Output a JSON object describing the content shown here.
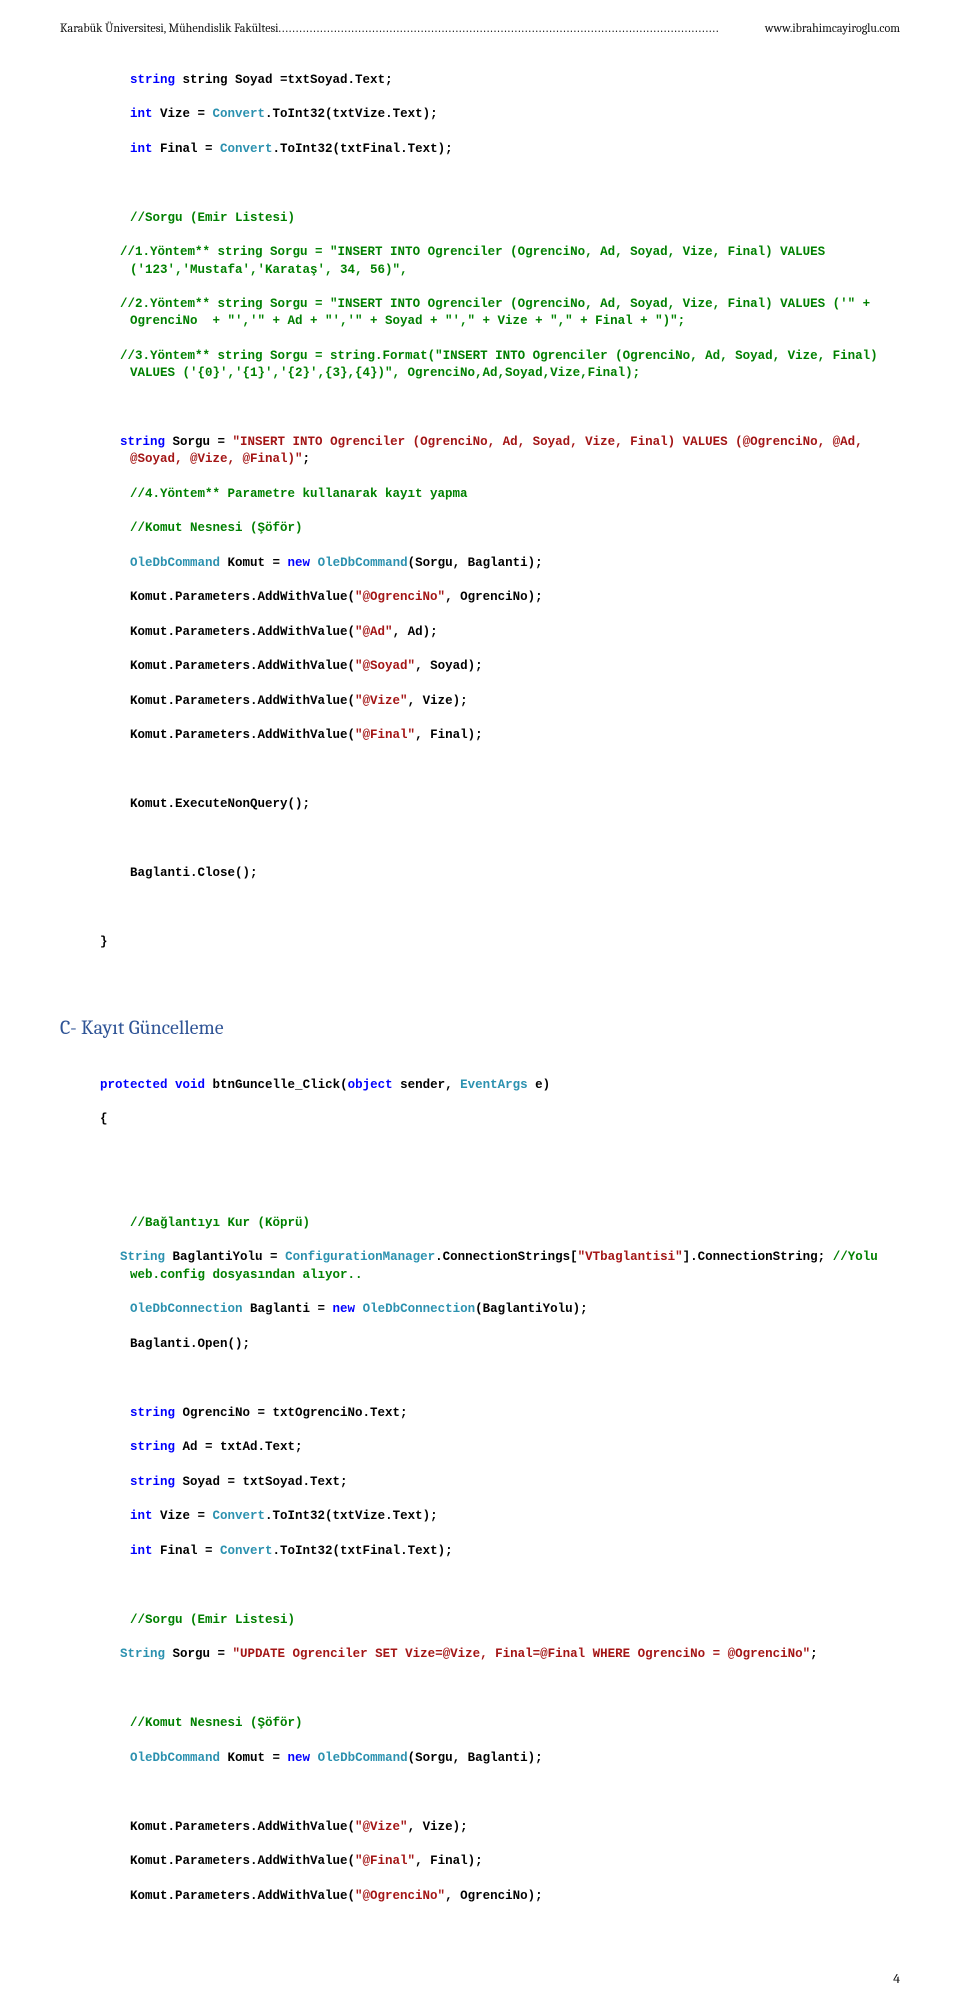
{
  "header": {
    "left": "Karabük Üniversitesi, Mühendislik Fakültesi",
    "right": "www.ibrahimcayiroglu.com"
  },
  "code1": {
    "l01": "string Soyad =txtSoyad.Text;",
    "l02a": "int Vize = ",
    "l02b": "Convert",
    "l02c": ".ToInt32(txtVize.Text);",
    "l03a": "int Final = ",
    "l03b": "Convert",
    "l03c": ".ToInt32(txtFinal.Text);",
    "l05": "//Sorgu (Emir Listesi)",
    "l06": "//1.Yöntem** string Sorgu = \"INSERT INTO Ogrenciler (OgrenciNo, Ad, Soyad, Vize, Final) VALUES ('123','Mustafa','Karataş', 34, 56)\",",
    "l07": "//2.Yöntem** string Sorgu = \"INSERT INTO Ogrenciler (OgrenciNo, Ad, Soyad, Vize, Final) VALUES ('\" + OgrenciNo  + \"','\" + Ad + \"','\" + Soyad + \"',\" + Vize + \",\" + Final + \")\";",
    "l08": "//3.Yöntem** string Sorgu = string.Format(\"INSERT INTO Ogrenciler (OgrenciNo, Ad, Soyad, Vize, Final) VALUES ('{0}','{1}','{2}',{3},{4})\", OgrenciNo,Ad,Soyad,Vize,Final);",
    "l09a": "string Sorgu = ",
    "l09b": "\"INSERT INTO Ogrenciler (OgrenciNo, Ad, Soyad, Vize, Final) VALUES (@OgrenciNo, @Ad, @Soyad, @Vize, @Final)\"",
    "l09c": ";",
    "l10": "//4.Yöntem** Parametre kullanarak kayıt yapma",
    "l11": "//Komut Nesnesi (Şöför)",
    "l12a": "OleDbCommand",
    "l12b": " Komut = ",
    "l12c": "new",
    "l12d": " ",
    "l12e": "OleDbCommand",
    "l12f": "(Sorgu, Baglanti);",
    "l13a": "Komut.Parameters.AddWithValue(",
    "l13b": "\"@OgrenciNo\"",
    "l13c": ", OgrenciNo);",
    "l14a": "Komut.Parameters.AddWithValue(",
    "l14b": "\"@Ad\"",
    "l14c": ", Ad);",
    "l15a": "Komut.Parameters.AddWithValue(",
    "l15b": "\"@Soyad\"",
    "l15c": ", Soyad);",
    "l16a": "Komut.Parameters.AddWithValue(",
    "l16b": "\"@Vize\"",
    "l16c": ", Vize);",
    "l17a": "Komut.Parameters.AddWithValue(",
    "l17b": "\"@Final\"",
    "l17c": ", Final);",
    "l19": "Komut.ExecuteNonQuery();",
    "l21": "Baglanti.Close();",
    "l23": "}"
  },
  "section_title": "C-  Kayıt Güncelleme",
  "code2": {
    "l01a": "protected",
    "l01b": " ",
    "l01c": "void",
    "l01d": " btnGuncelle_Click(",
    "l01e": "object",
    "l01f": " sender, ",
    "l01g": "EventArgs",
    "l01h": " e)",
    "l02": "{",
    "l04": "//Bağlantıyı Kur (Köprü)",
    "l05a": "String",
    "l05b": " BaglantiYolu = ",
    "l05c": "ConfigurationManager",
    "l05d": ".ConnectionStrings[",
    "l05e": "\"VTbaglantisi\"",
    "l05f": "].ConnectionString; ",
    "l05g": "//Yolu web.config dosyasından alıyor..",
    "l06a": "OleDbConnection",
    "l06b": " Baglanti = ",
    "l06c": "new",
    "l06d": " ",
    "l06e": "OleDbConnection",
    "l06f": "(BaglantiYolu);",
    "l07": "Baglanti.Open();",
    "l09a": "string",
    "l09b": " OgrenciNo = txtOgrenciNo.Text;",
    "l10a": "string",
    "l10b": " Ad = txtAd.Text;",
    "l11a": "string",
    "l11b": " Soyad = txtSoyad.Text;",
    "l12a": "int",
    "l12b": " Vize = ",
    "l12c": "Convert",
    "l12d": ".ToInt32(txtVize.Text);",
    "l13a": "int",
    "l13b": " Final = ",
    "l13c": "Convert",
    "l13d": ".ToInt32(txtFinal.Text);",
    "l15": "//Sorgu (Emir Listesi)",
    "l16a": "String",
    "l16b": " Sorgu = ",
    "l16c": "\"UPDATE Ogrenciler SET Vize=@Vize, Final=@Final WHERE OgrenciNo = @OgrenciNo\"",
    "l16d": ";",
    "l18": "//Komut Nesnesi (Şöför)",
    "l19a": "OleDbCommand",
    "l19b": " Komut = ",
    "l19c": "new",
    "l19d": " ",
    "l19e": "OleDbCommand",
    "l19f": "(Sorgu, Baglanti);",
    "l21a": "Komut.Parameters.AddWithValue(",
    "l21b": "\"@Vize\"",
    "l21c": ", Vize);",
    "l22a": "Komut.Parameters.AddWithValue(",
    "l22b": "\"@Final\"",
    "l22c": ", Final);",
    "l23a": "Komut.Parameters.AddWithValue(",
    "l23b": "\"@OgrenciNo\"",
    "l23c": ", OgrenciNo);"
  },
  "page_number": "4"
}
